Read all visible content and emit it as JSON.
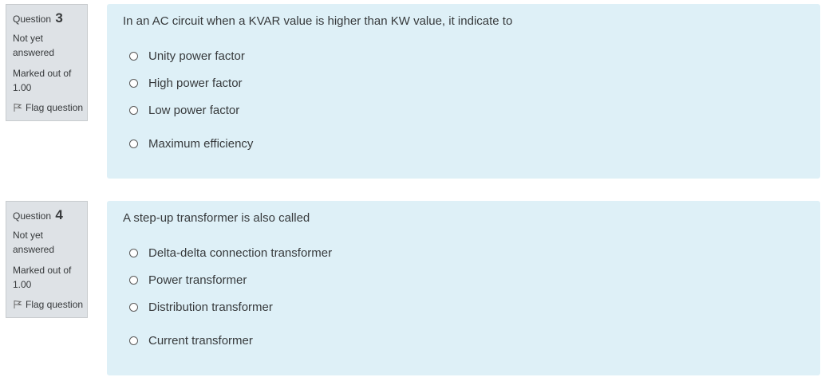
{
  "questions": [
    {
      "label": "Question",
      "number": "3",
      "state": "Not yet answered",
      "grade": "Marked out of 1.00",
      "flag": "Flag question",
      "text": "In an AC circuit when a KVAR value is higher than KW value, it indicate to",
      "options": [
        "Unity power factor",
        "High power factor",
        "Low power factor",
        "Maximum efficiency"
      ]
    },
    {
      "label": "Question",
      "number": "4",
      "state": "Not yet answered",
      "grade": "Marked out of 1.00",
      "flag": "Flag question",
      "text": "A step-up transformer is also called",
      "options": [
        "Delta-delta connection transformer",
        "Power transformer",
        "Distribution transformer",
        "Current transformer"
      ]
    }
  ],
  "colors": {
    "info_bg": "#dee2e6",
    "content_bg": "#def0f7",
    "text": "#373a3c"
  },
  "icons": {
    "flag": "flag-icon",
    "radio": "radio-unchecked-icon"
  }
}
